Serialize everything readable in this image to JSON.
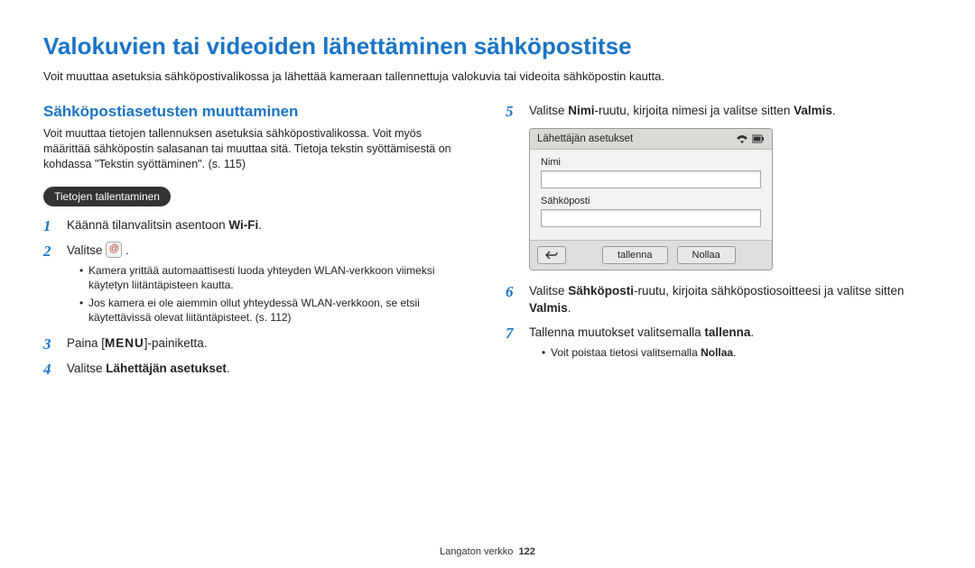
{
  "title": "Valokuvien tai videoiden lähettäminen sähköpostitse",
  "intro": "Voit muuttaa asetuksia sähköpostivalikossa ja lähettää kameraan tallennettuja valokuvia tai videoita sähköpostin kautta.",
  "section_heading": "Sähköpostiasetusten muuttaminen",
  "section_body": "Voit muuttaa tietojen tallennuksen asetuksia sähköpostivalikossa. Voit myös määrittää sähköpostin salasanan tai muuttaa sitä. Tietoja tekstin syöttämisestä on kohdassa \"Tekstin syöttäminen\". (s. 115)",
  "pill": "Tietojen tallentaminen",
  "left_steps": {
    "s1_pre": "Käännä tilanvalitsin asentoon ",
    "s1_wifi": "Wi-Fi",
    "s1_post": ".",
    "s2_pre": "Valitse ",
    "s2_post": " .",
    "s2_b1": "Kamera yrittää automaattisesti luoda yhteyden WLAN-verkkoon viimeksi käytetyn liitäntäpisteen kautta.",
    "s2_b2": "Jos kamera ei ole aiemmin ollut yhteydessä WLAN-verkkoon, se etsii käytettävissä olevat liitäntäpisteet. (s. 112)",
    "s3_pre": "Paina [",
    "s3_menu": "MENU",
    "s3_post": "]-painiketta.",
    "s4_pre": "Valitse ",
    "s4_bold": "Lähettäjän asetukset",
    "s4_post": "."
  },
  "right_steps": {
    "s5_pre": "Valitse ",
    "s5_b1": "Nimi",
    "s5_mid": "-ruutu, kirjoita nimesi ja valitse sitten ",
    "s5_b2": "Valmis",
    "s5_post": ".",
    "s6_pre": "Valitse ",
    "s6_b1": "Sähköposti",
    "s6_mid": "-ruutu, kirjoita sähköpostiosoitteesi ja valitse sitten ",
    "s6_b2": "Valmis",
    "s6_post": ".",
    "s7_pre": "Tallenna muutokset valitsemalla ",
    "s7_b1": "tallenna",
    "s7_post": ".",
    "s7_bullet_pre": "Voit poistaa tietosi valitsemalla ",
    "s7_bullet_b": "Nollaa",
    "s7_bullet_post": "."
  },
  "device": {
    "header": "Lähettäjän asetukset",
    "field1": "Nimi",
    "field2": "Sähköposti",
    "btn_save": "tallenna",
    "btn_reset": "Nollaa"
  },
  "footer": {
    "section": "Langaton verkko",
    "page": "122"
  }
}
